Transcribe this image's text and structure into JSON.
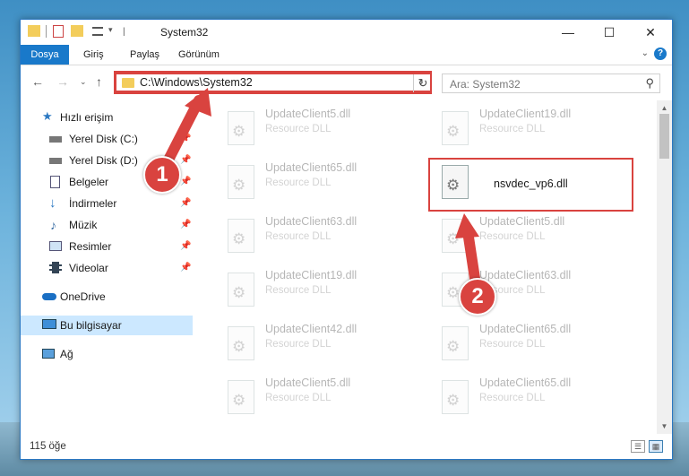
{
  "window": {
    "title": "System32"
  },
  "ribbon": {
    "tabs": [
      "Dosya",
      "Giriş",
      "Paylaş",
      "Görünüm"
    ]
  },
  "address": {
    "path": "C:\\Windows\\System32"
  },
  "search": {
    "placeholder": "Ara: System32"
  },
  "sidebar": {
    "items": [
      {
        "label": "Hızlı erişim",
        "icon": "star-icon"
      },
      {
        "label": "Yerel Disk (C:)",
        "icon": "drive-icon"
      },
      {
        "label": "Yerel Disk (D:)",
        "icon": "drive-icon"
      },
      {
        "label": "Belgeler",
        "icon": "document-icon"
      },
      {
        "label": "İndirmeler",
        "icon": "download-icon"
      },
      {
        "label": "Müzik",
        "icon": "music-icon"
      },
      {
        "label": "Resimler",
        "icon": "pictures-icon"
      },
      {
        "label": "Videolar",
        "icon": "video-icon"
      },
      {
        "label": "OneDrive",
        "icon": "cloud-icon"
      },
      {
        "label": "Bu bilgisayar",
        "icon": "computer-icon"
      },
      {
        "label": "Ağ",
        "icon": "network-icon"
      }
    ]
  },
  "files": [
    {
      "name": "UpdateClient5.dll",
      "type": "Resource DLL"
    },
    {
      "name": "UpdateClient19.dll",
      "type": "Resource DLL"
    },
    {
      "name": "UpdateClient65.dll",
      "type": "Resource DLL"
    },
    {
      "name": "nsvdec_vp6.dll",
      "type": ""
    },
    {
      "name": "UpdateClient63.dll",
      "type": "Resource DLL"
    },
    {
      "name": "UpdateClient5.dll",
      "type": "Resource DLL"
    },
    {
      "name": "UpdateClient19.dll",
      "type": "Resource DLL"
    },
    {
      "name": "UpdateClient63.dll",
      "type": "Resource DLL"
    },
    {
      "name": "UpdateClient42.dll",
      "type": "Resource DLL"
    },
    {
      "name": "UpdateClient65.dll",
      "type": "Resource DLL"
    },
    {
      "name": "UpdateClient5.dll",
      "type": "Resource DLL"
    },
    {
      "name": "UpdateClient65.dll",
      "type": "Resource DLL"
    }
  ],
  "status": {
    "count": "115 öğe"
  },
  "annotations": {
    "step1": "1",
    "step2": "2",
    "color": "#d9433f"
  }
}
